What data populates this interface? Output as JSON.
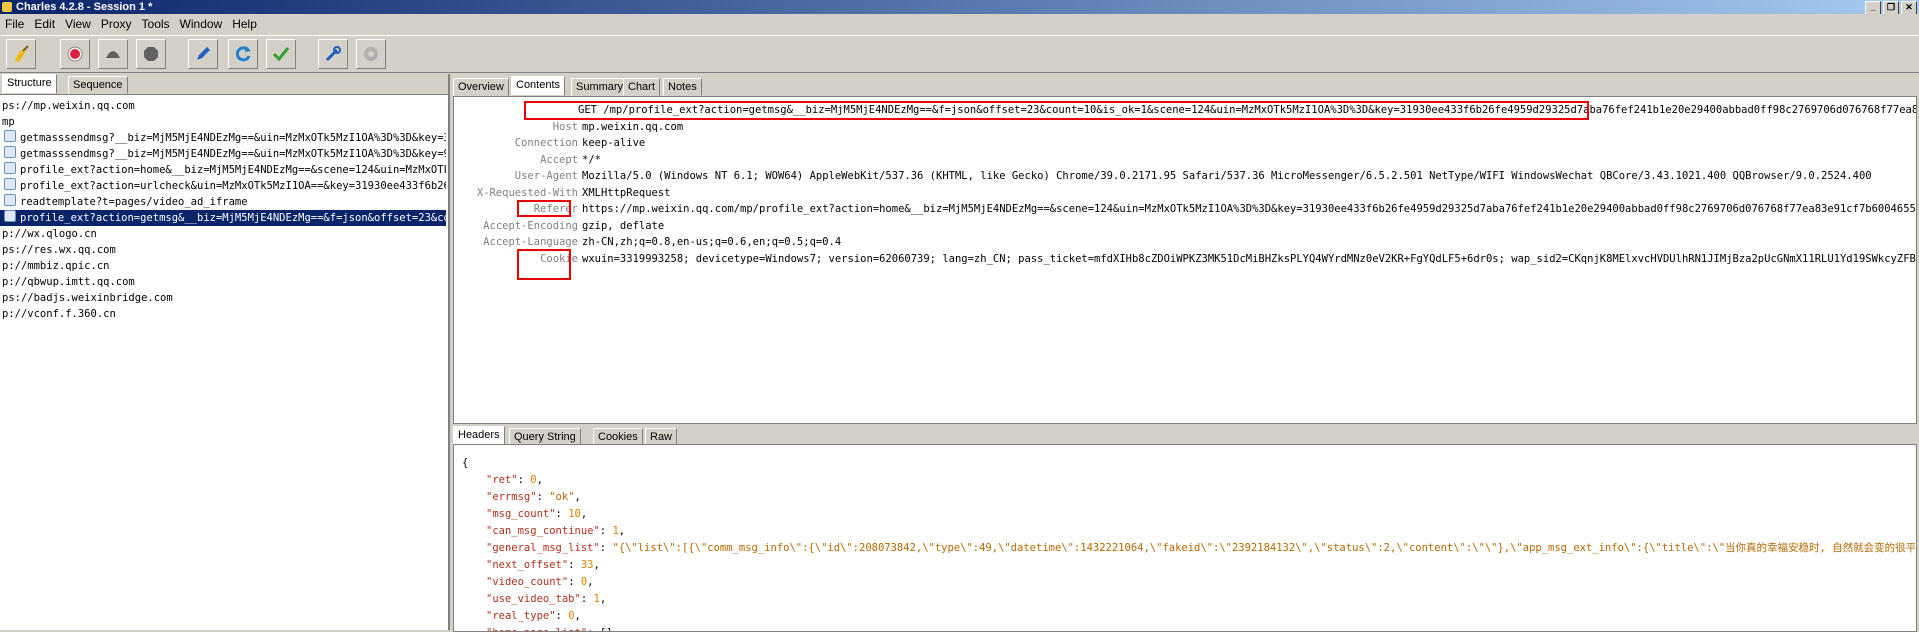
{
  "window": {
    "title": "Charles 4.2.8 - Session 1 *"
  },
  "menu": [
    "File",
    "Edit",
    "View",
    "Proxy",
    "Tools",
    "Window",
    "Help"
  ],
  "toolbar": [
    {
      "name": "broom-icon",
      "color": "#f0b800"
    },
    {
      "name": "record-icon",
      "color": "#e02040"
    },
    {
      "name": "throttle-icon",
      "color": "#606060"
    },
    {
      "name": "stop-icon",
      "color": "#606060"
    },
    {
      "name": "pen-icon",
      "color": "#2060c0"
    },
    {
      "name": "refresh-icon",
      "color": "#2080d0"
    },
    {
      "name": "check-icon",
      "color": "#30a030"
    },
    {
      "name": "tools-icon",
      "color": "#2060c0"
    },
    {
      "name": "gear-icon",
      "color": "#909090"
    }
  ],
  "left_tabs": [
    "Structure",
    "Sequence"
  ],
  "tree": [
    {
      "text": "ps://mp.weixin.qq.com",
      "icon": false,
      "selected": false
    },
    {
      "text": "mp",
      "icon": false,
      "selected": false
    },
    {
      "text": "getmasssendmsg?__biz=MjM5MjE4NDEzMg==&uin=MzMxOTk5MzI1OA%3D%3D&key=3193",
      "icon": true,
      "selected": false
    },
    {
      "text": "getmasssendmsg?__biz=MjM5MjE4NDEzMg==&uin=MzMxOTk5MzI1OA%3D%3D&key=9f33",
      "icon": true,
      "selected": false
    },
    {
      "text": "profile_ext?action=home&__biz=MjM5MjE4NDEzMg==&scene=124&uin=MzMxOTk5Mz",
      "icon": true,
      "selected": false
    },
    {
      "text": "profile_ext?action=urlcheck&uin=MzMxOTk5MzI1OA==&key=31930ee433f6b26fe",
      "icon": true,
      "selected": false
    },
    {
      "text": "readtemplate?t=pages/video_ad_iframe",
      "icon": true,
      "selected": false
    },
    {
      "text": "profile_ext?action=getmsg&__biz=MjM5MjE4NDEzMg==&f=json&offset=23&count",
      "icon": true,
      "selected": true
    },
    {
      "text": "p://wx.qlogo.cn",
      "icon": false,
      "selected": false
    },
    {
      "text": "ps://res.wx.qq.com",
      "icon": false,
      "selected": false
    },
    {
      "text": "p://mmbiz.qpic.cn",
      "icon": false,
      "selected": false
    },
    {
      "text": "p://qbwup.imtt.qq.com",
      "icon": false,
      "selected": false
    },
    {
      "text": "ps://badjs.weixinbridge.com",
      "icon": false,
      "selected": false
    },
    {
      "text": "p://vconf.f.360.cn",
      "icon": false,
      "selected": false
    }
  ],
  "right_tabs": [
    "Overview",
    "Contents",
    "Summary",
    "Chart",
    "Notes"
  ],
  "request_headers": [
    {
      "key": "",
      "value": "GET /mp/profile_ext?action=getmsg&__biz=MjM5MjE4NDEzMg==&f=json&offset=23&count=10&is_ok=1&scene=124&uin=MzMxOTk5MzI1OA%3D%3D&key=31930ee433f6b26fe4959d29325d7aba76fef241b1e20e29400abbad0ff98c2769706d076768f77ea83e91cf..."
    },
    {
      "key": "Host",
      "value": "mp.weixin.qq.com"
    },
    {
      "key": "Connection",
      "value": "keep-alive"
    },
    {
      "key": "Accept",
      "value": "*/*"
    },
    {
      "key": "User-Agent",
      "value": "Mozilla/5.0 (Windows NT 6.1; WOW64) AppleWebKit/537.36 (KHTML, like Gecko) Chrome/39.0.2171.95 Safari/537.36 MicroMessenger/6.5.2.501 NetType/WIFI WindowsWechat QBCore/3.43.1021.400 QQBrowser/9.0.2524.400"
    },
    {
      "key": "X-Requested-With",
      "value": "XMLHttpRequest"
    },
    {
      "key": "Referer",
      "value": "https://mp.weixin.qq.com/mp/profile_ext?action=home&__biz=MjM5MjE4NDEzMg==&scene=124&uin=MzMxOTk5MzI1OA%3D%3D&key=31930ee433f6b26fe4959d29325d7aba76fef241b1e20e29400abbad0ff98c2769706d076768f77ea83e91cf7b6004655b482f51..."
    },
    {
      "key": "Accept-Encoding",
      "value": "gzip, deflate"
    },
    {
      "key": "Accept-Language",
      "value": "zh-CN,zh;q=0.8,en-us;q=0.6,en;q=0.5;q=0.4"
    },
    {
      "key": "Cookie",
      "value": "wxuin=3319993258; devicetype=Windows7; version=62060739; lang=zh_CN; pass_ticket=mfdXIHb8cZDOiWPKZ3MK51DcMiBHZksPLYQ4WYrdMNz0eV2KR+FgYQdLF5+6dr0s; wap_sid2=CKqnjK8MElxvcHVDUlhRN1JIMjBza2pUcGNmX11RLU1Yd19SWkcyZFB4b0ZyeGR..."
    }
  ],
  "bottom_tabs": [
    "Headers",
    "Query String",
    "Cookies",
    "Raw"
  ],
  "json_lines": [
    {
      "key": "",
      "val": "{",
      "t": "p"
    },
    {
      "key": "\"ret\"",
      "val": "0",
      "t": "n"
    },
    {
      "key": "\"errmsg\"",
      "val": "\"ok\"",
      "t": "s"
    },
    {
      "key": "\"msg_count\"",
      "val": "10",
      "t": "n"
    },
    {
      "key": "\"can_msg_continue\"",
      "val": "1",
      "t": "n"
    },
    {
      "key": "\"general_msg_list\"",
      "val": "\"{\\\"list\\\":[{\\\"comm_msg_info\\\":{\\\"id\\\":208073842,\\\"type\\\":49,\\\"datetime\\\":1432221064,\\\"fakeid\\\":\\\"2392184132\\\",\\\"status\\\":2,\\\"content\\\":\\\"\\\"},\\\"app_msg_ext_info\\\":{\\\"title\\\":\\\"当你真的幸福安稳时, 自然就会变的很平和\\\",\\\"di",
      "t": "s"
    },
    {
      "key": "\"next_offset\"",
      "val": "33",
      "t": "n"
    },
    {
      "key": "\"video_count\"",
      "val": "0",
      "t": "n"
    },
    {
      "key": "\"use_video_tab\"",
      "val": "1",
      "t": "n"
    },
    {
      "key": "\"real_type\"",
      "val": "0",
      "t": "n"
    },
    {
      "key": "\"home_page_list\"",
      "val": "[]",
      "t": "p"
    },
    {
      "key": "",
      "val": "}",
      "t": "p"
    }
  ]
}
